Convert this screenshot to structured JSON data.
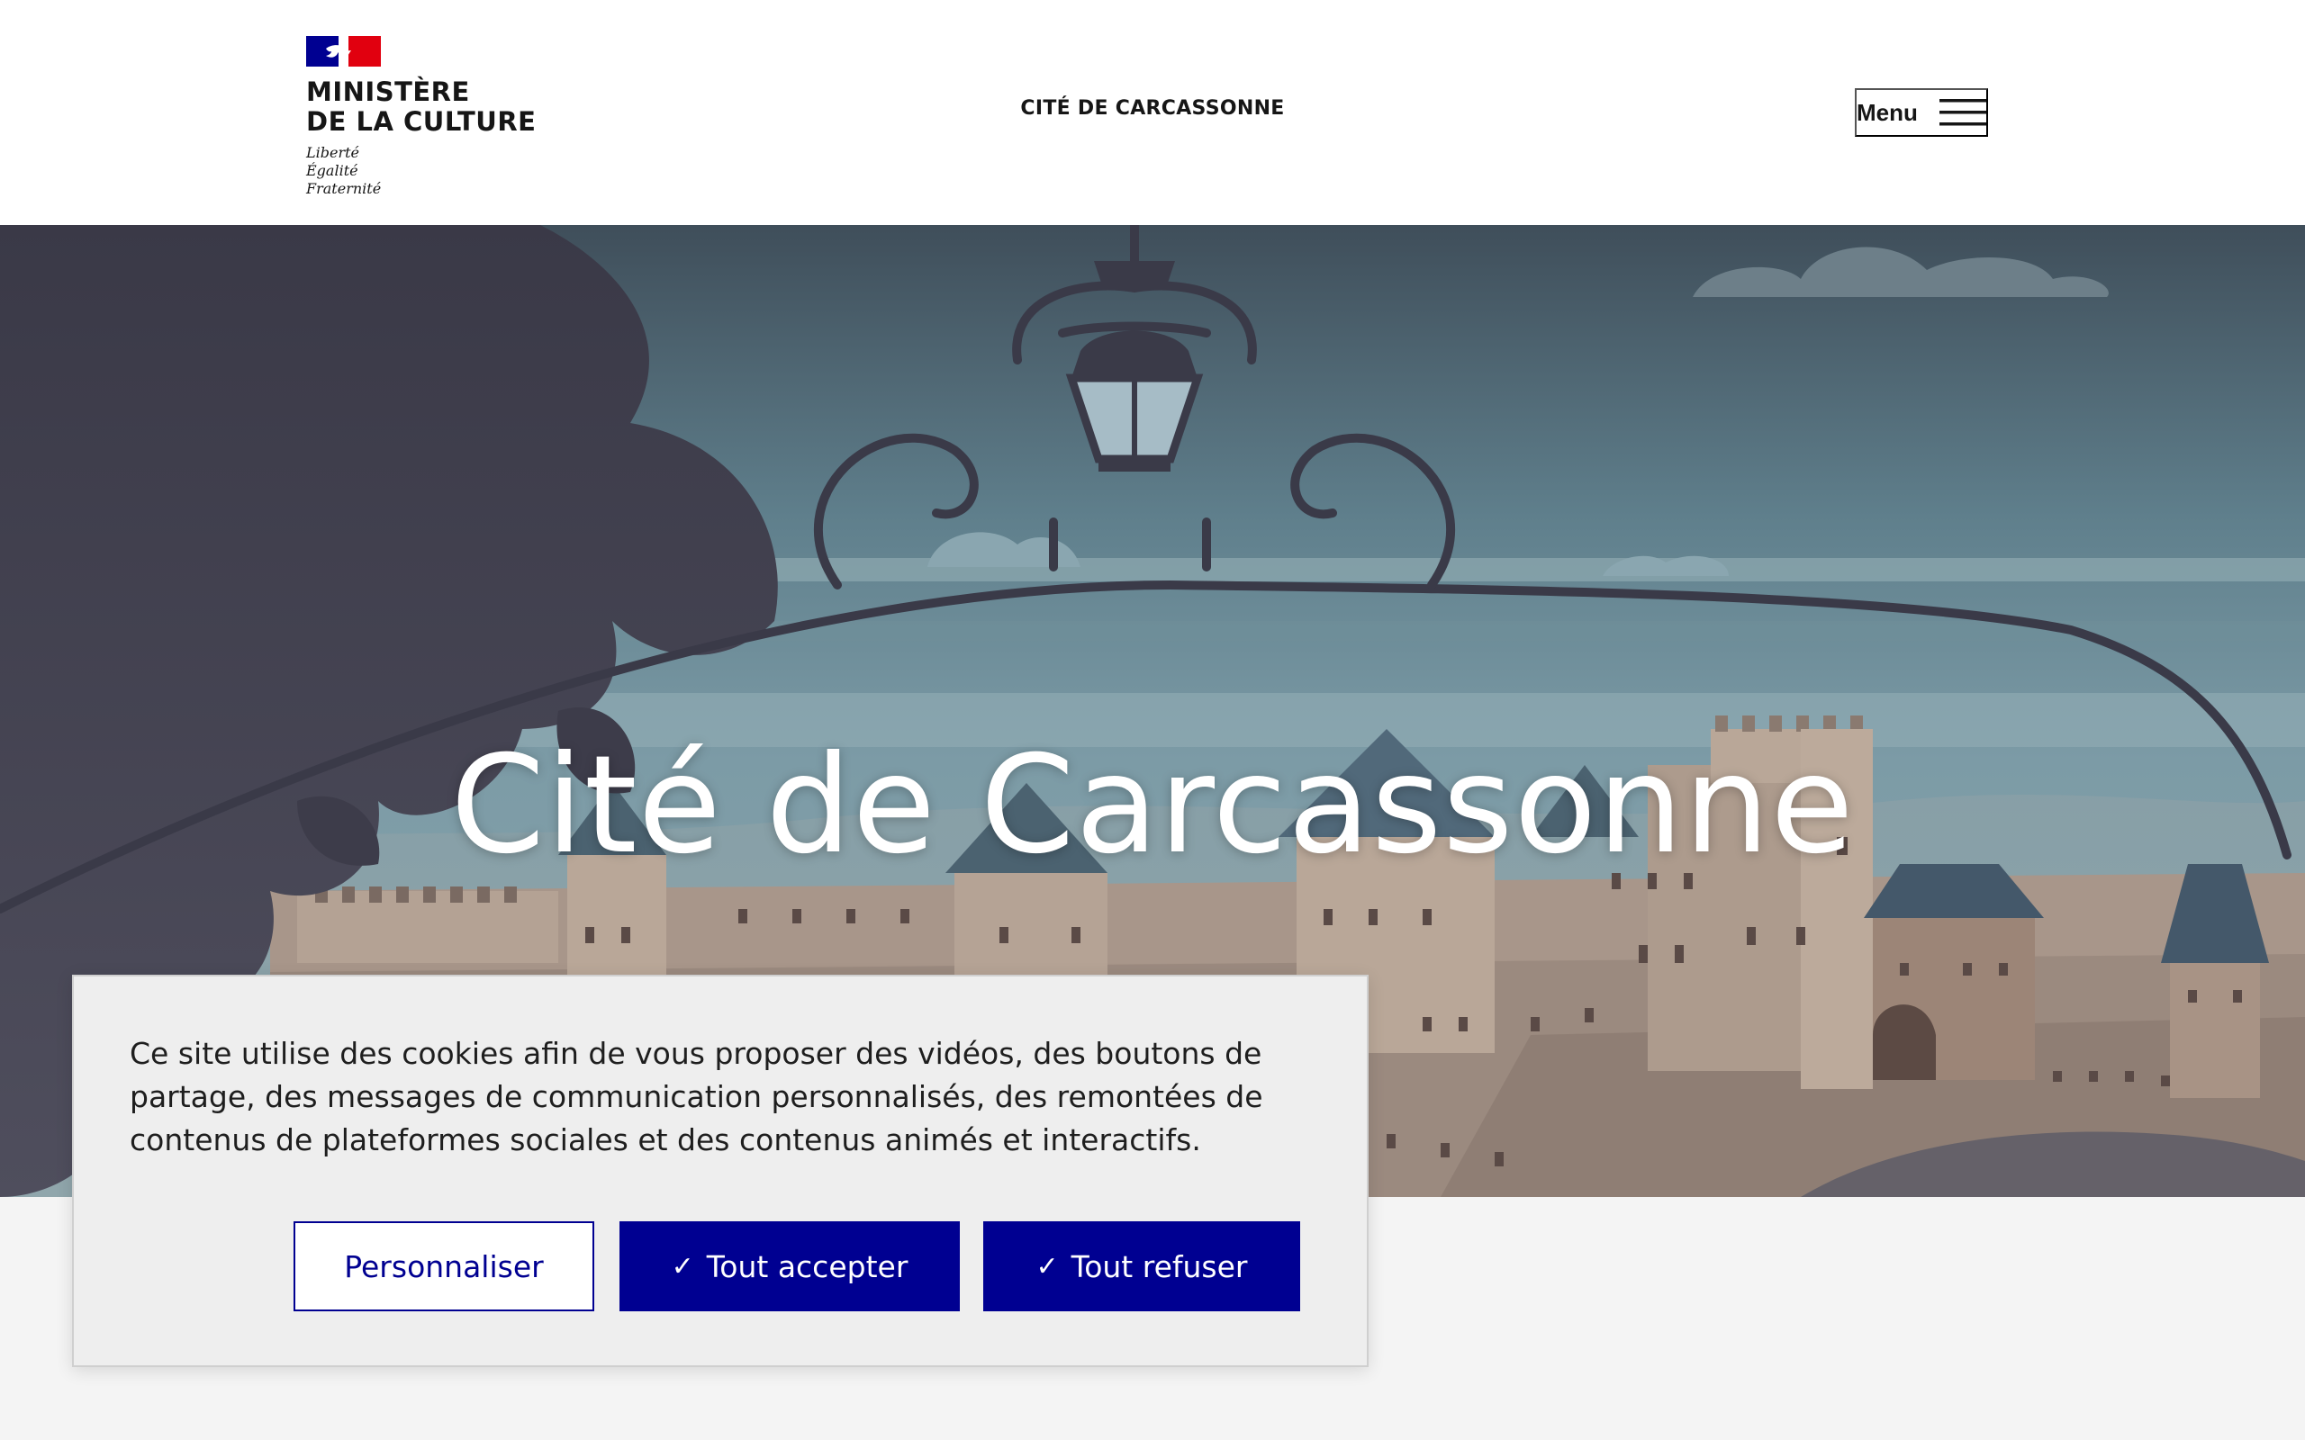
{
  "header": {
    "ministry_line1": "MINISTÈRE",
    "ministry_line2": "DE LA CULTURE",
    "motto": [
      "Liberté",
      "Égalité",
      "Fraternité"
    ],
    "site_title": "CITÉ DE CARCASSONNE",
    "menu_label": "Menu",
    "menu_icon": "hamburger-icon"
  },
  "hero": {
    "title": "Cité de Carcassonne"
  },
  "cookie_banner": {
    "text": "Ce site utilise des cookies afin de vous proposer des vidéos, des boutons de partage, des messages de communication personnalisés, des remontées de contenus de plateformes sociales et des contenus animés et interactifs.",
    "customize_label": "Personnaliser",
    "accept_label": "Tout accepter",
    "refuse_label": "Tout refuser",
    "check_icon": "✓"
  },
  "colors": {
    "brand_blue": "#000091",
    "flag_blue": "#000091",
    "flag_red": "#e1000f",
    "header_bg": "#ffffff",
    "page_bg": "#f4f4f4"
  }
}
